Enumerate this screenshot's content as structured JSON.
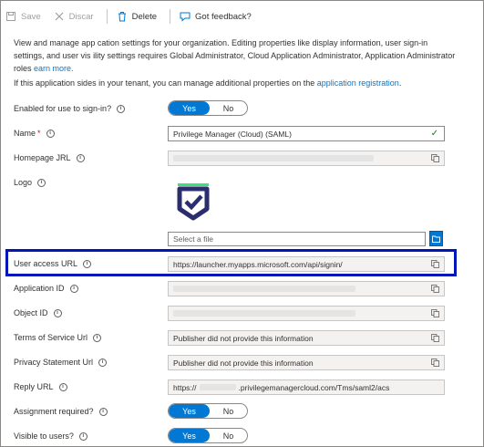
{
  "toolbar": {
    "save_label": "Save",
    "discard_label": "Discar",
    "delete_label": "Delete",
    "feedback_label": "Got feedback?"
  },
  "description": {
    "part1": "View and manage app",
    "part2": "cation settings for your organization. Editing properties like display information, user sign-in settings, and user vis",
    "part3": "ility settings requires Global Administrator, Cloud Application Administrator, Application Administrator roles",
    "learn_more": "earn more."
  },
  "registration_note": {
    "text_a": "If this application",
    "text_b": "sides in your tenant, you can manage additional properties on the",
    "link": "application registration",
    "end": "."
  },
  "fields": {
    "enabled_label": "Enabled for use   to sign-in?",
    "name_label": "Name",
    "name_required": "*",
    "name_value": "Privilege Manager (Cloud) (SAML)",
    "homepage_label": "Homepage  JRL",
    "logo_label": "Logo",
    "file_placeholder": "Select a file",
    "user_access_label": "User access URL",
    "user_access_value": "https://launcher.myapps.microsoft.com/api/signin/",
    "app_id_label": "Application ID",
    "object_id_label": "Object ID",
    "tos_label": "Terms of Service Url",
    "tos_value": "Publisher did not provide this information",
    "privacy_label": "Privacy Statement Url",
    "privacy_value": "Publisher did not provide this information",
    "reply_label": "Reply URL",
    "reply_prefix": "https://",
    "reply_suffix": ".privilegemanagercloud.com/Tms/saml2/acs",
    "assignment_label": "Assignment required?",
    "visible_label": "Visible to users?"
  },
  "toggle": {
    "yes": "Yes",
    "no": "No"
  },
  "colors": {
    "accent": "#0078d4",
    "highlight": "#0016ba",
    "logo": "#2b2d6e",
    "logo_accent": "#3ce07a"
  }
}
